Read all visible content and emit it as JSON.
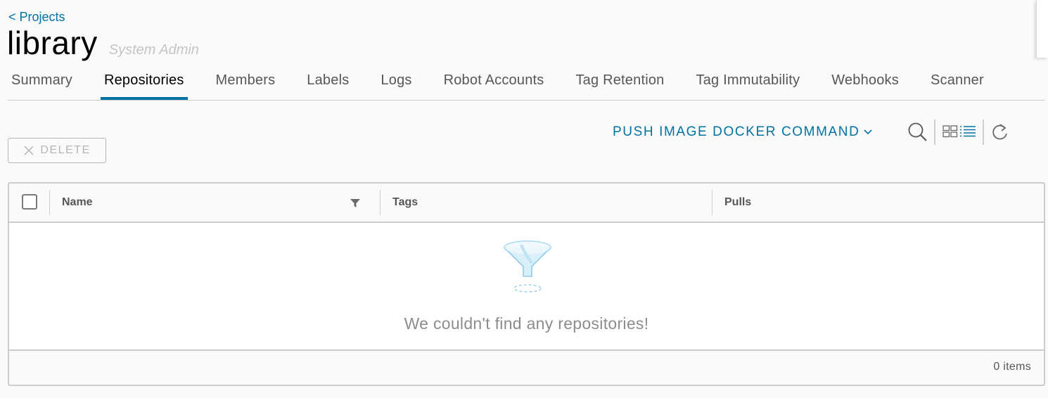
{
  "header": {
    "back_link": "< Projects",
    "title": "library",
    "role": "System Admin"
  },
  "tabs": [
    {
      "label": "Summary",
      "active": false
    },
    {
      "label": "Repositories",
      "active": true
    },
    {
      "label": "Members",
      "active": false
    },
    {
      "label": "Labels",
      "active": false
    },
    {
      "label": "Logs",
      "active": false
    },
    {
      "label": "Robot Accounts",
      "active": false
    },
    {
      "label": "Tag Retention",
      "active": false
    },
    {
      "label": "Tag Immutability",
      "active": false
    },
    {
      "label": "Webhooks",
      "active": false
    },
    {
      "label": "Scanner",
      "active": false
    }
  ],
  "toolbar": {
    "delete_label": "DELETE",
    "push_command_label": "PUSH IMAGE DOCKER COMMAND",
    "icons": [
      "close-icon",
      "chevron-down-icon",
      "search-icon",
      "card-view-icon",
      "list-view-icon",
      "refresh-icon"
    ]
  },
  "grid": {
    "columns": [
      "Name",
      "Tags",
      "Pulls"
    ],
    "empty_message": "We couldn't find any repositories!",
    "footer_count": "0 items"
  },
  "colors": {
    "accent": "#0072a3",
    "background": "#fafafa",
    "border": "#cccccc",
    "muted_text": "#8c8c8c"
  }
}
